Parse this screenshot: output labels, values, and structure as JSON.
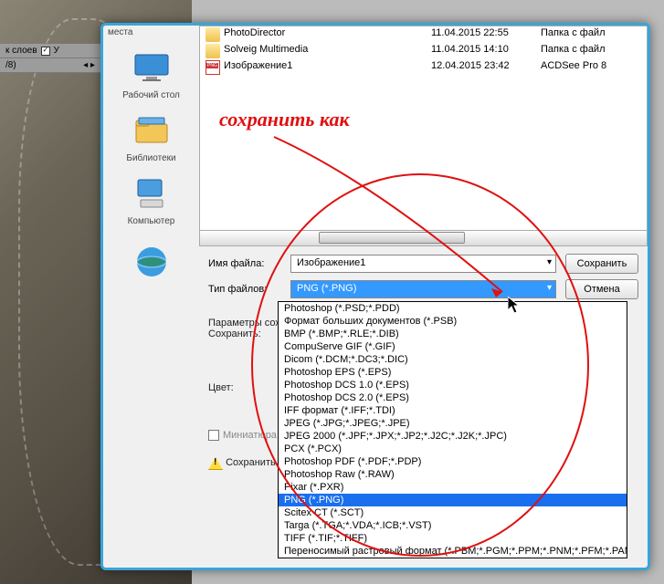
{
  "ps": {
    "layers_label": "к слоев",
    "ratio": "/8)"
  },
  "places": [
    {
      "label": "места"
    },
    {
      "label": "Рабочий стол"
    },
    {
      "label": "Библиотеки"
    },
    {
      "label": "Компьютер"
    },
    {
      "label": ""
    }
  ],
  "files": [
    {
      "icon": "folder",
      "name": "PhotoDirector",
      "date": "11.04.2015 22:55",
      "type": "Папка с файл"
    },
    {
      "icon": "folder",
      "name": "Solveig Multimedia",
      "date": "11.04.2015 14:10",
      "type": "Папка с файл"
    },
    {
      "icon": "png",
      "name": "Изображение1",
      "date": "12.04.2015 23:42",
      "type": "ACDSee Pro 8"
    }
  ],
  "fields": {
    "filename_label": "Имя файла:",
    "filename_value": "Изображение1",
    "filetype_label": "Тип файлов:",
    "filetype_value": "PNG (*.PNG)",
    "save_btn": "Сохранить",
    "cancel_btn": "Отмена"
  },
  "options": {
    "params_label": "Параметры сохранен",
    "save_label": "Сохранить:",
    "color_label": "Цвет:",
    "thumb_label": "Миниатюра",
    "warn_footer": "Сохранить файл"
  },
  "formats": [
    "Photoshop (*.PSD;*.PDD)",
    "Формат больших документов (*.PSB)",
    "BMP (*.BMP;*.RLE;*.DIB)",
    "CompuServe GIF (*.GIF)",
    "Dicom (*.DCM;*.DC3;*.DIC)",
    "Photoshop EPS (*.EPS)",
    "Photoshop DCS 1.0 (*.EPS)",
    "Photoshop DCS 2.0 (*.EPS)",
    "IFF формат (*.IFF;*.TDI)",
    "JPEG (*.JPG;*.JPEG;*.JPE)",
    "JPEG 2000 (*.JPF;*.JPX;*.JP2;*.J2C;*.J2K;*.JPC)",
    "PCX (*.PCX)",
    "Photoshop PDF (*.PDF;*.PDP)",
    "Photoshop Raw (*.RAW)",
    "Pixar (*.PXR)",
    "PNG (*.PNG)",
    "Scitex CT (*.SCT)",
    "Targa (*.TGA;*.VDA;*.ICB;*.VST)",
    "TIFF (*.TIF;*.TIFF)",
    "Переносимый растровый формат (*.PBM;*.PGM;*.PPM;*.PNM;*.PFM;*.PAM)"
  ],
  "format_selected_index": 15,
  "annotation": "сохранить как"
}
